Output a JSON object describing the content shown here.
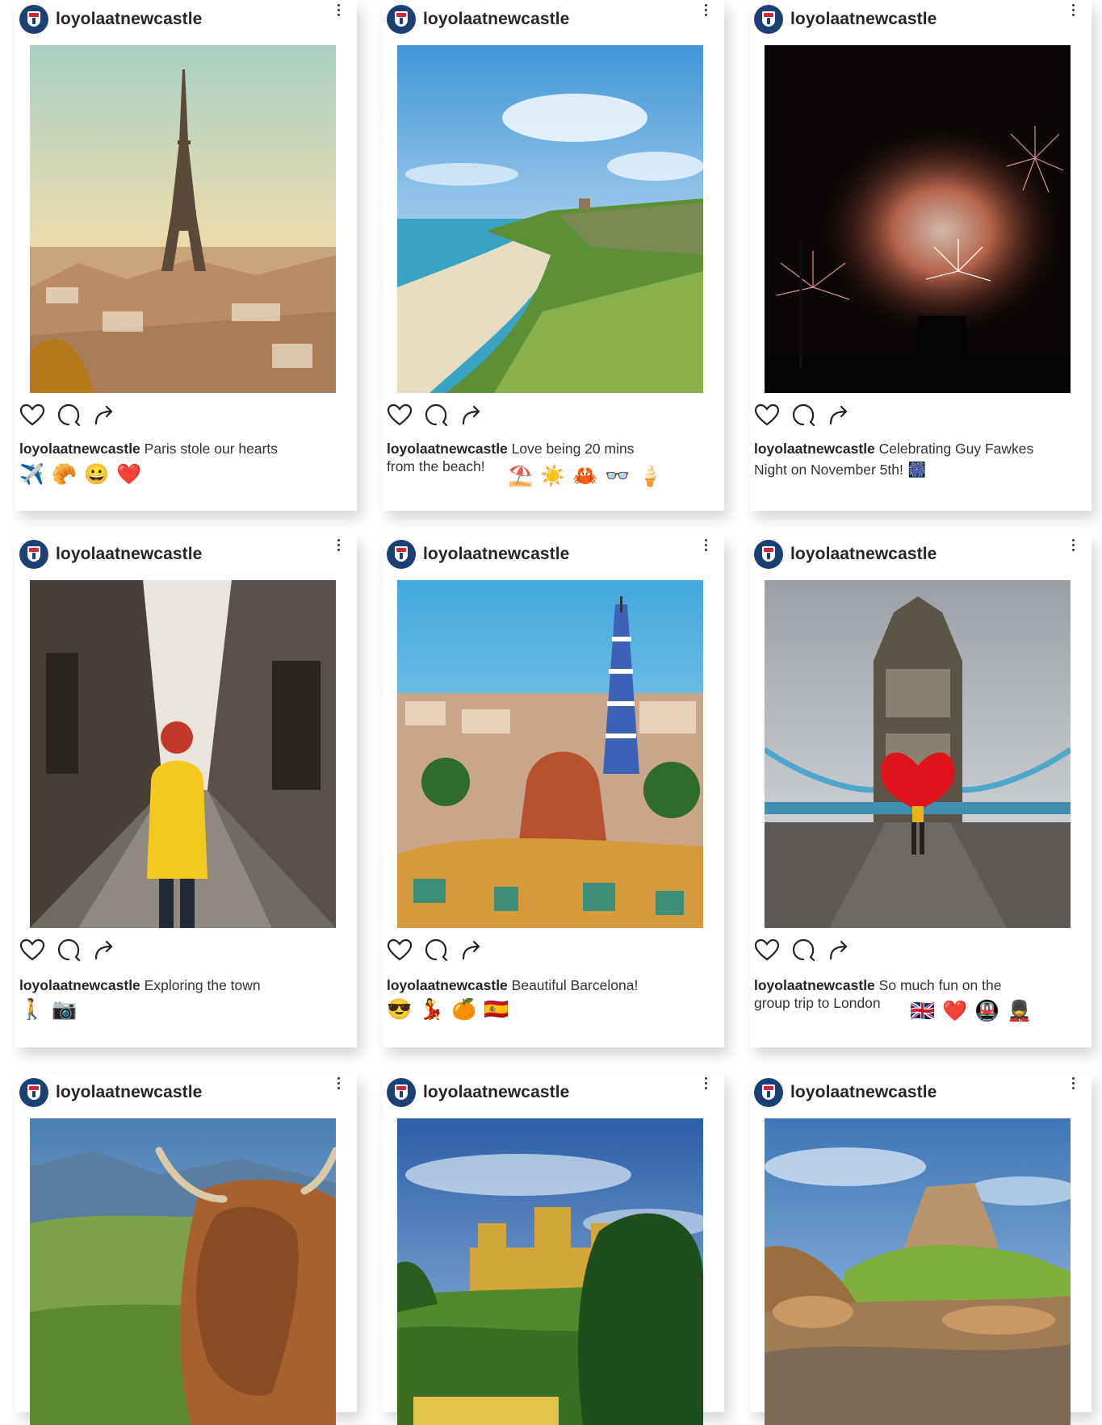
{
  "username": "loyolaatnewcastle",
  "posts": [
    {
      "image": "Eiffel Tower over Paris rooftops",
      "caption": "Paris stole our hearts",
      "emojis": [
        "✈️",
        "🥐",
        "😀",
        "❤️"
      ]
    },
    {
      "image": "Coastal beach with cliffs and castle",
      "caption": "Love being 20 mins from the beach!",
      "caption_lines": [
        "Love being 20 mins",
        "from the beach!"
      ],
      "emojis": [
        "⛱️",
        "☀️",
        "🦀",
        "👓",
        "🍦"
      ]
    },
    {
      "image": "Fireworks in the night sky",
      "caption": "Celebrating Guy Fawkes Night on November 5th!",
      "caption_lines": [
        "Celebrating Guy Fawkes",
        "Night on November 5th!"
      ],
      "emojis": [
        "🎆"
      ]
    },
    {
      "image": "Person in yellow coat walking down a cobbled street",
      "caption": "Exploring the town",
      "emojis": [
        "🚶",
        "📷"
      ]
    },
    {
      "image": "Park Güell mosaic view over Barcelona",
      "caption": "Beautiful Barcelona!",
      "emojis": [
        "😎",
        "💃",
        "🍊",
        "🇪🇸"
      ]
    },
    {
      "image": "Person with red heart umbrella on Tower Bridge",
      "caption": "So much fun on the group trip to London",
      "caption_lines": [
        "So much fun on the",
        "group trip to London"
      ],
      "emojis": [
        "🇬🇧",
        "❤️",
        "🚇",
        "💂"
      ]
    },
    {
      "image": "Highland cow in green landscape"
    },
    {
      "image": "Castle on a green hill"
    },
    {
      "image": "Holy Island castle above rocky shore"
    }
  ],
  "colors": {
    "brand_navy": "#1c3f74",
    "brand_red": "#d3263a",
    "text": "#262626"
  },
  "icons": [
    "heart-icon",
    "comment-icon",
    "share-icon",
    "more-options-icon"
  ]
}
